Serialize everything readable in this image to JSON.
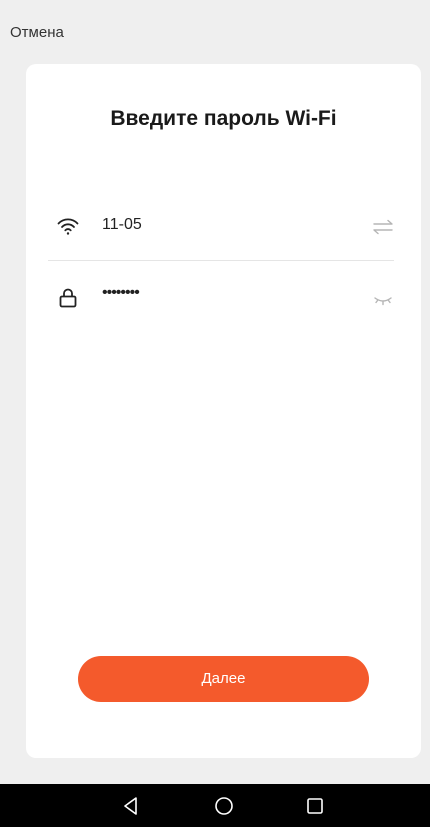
{
  "header": {
    "cancel_label": "Отмена"
  },
  "card": {
    "title": "Введите пароль Wi-Fi"
  },
  "ssid_row": {
    "icon": "wifi-icon",
    "value": "11-05",
    "action_icon": "switch-network-icon"
  },
  "password_row": {
    "icon": "lock-icon",
    "value": "••••••••",
    "action_icon": "eye-closed-icon"
  },
  "next_button": {
    "label": "Далее"
  },
  "colors": {
    "accent": "#f45a2c",
    "background": "#efefef",
    "card": "#ffffff"
  },
  "nav_bar": {
    "icons": [
      "back-icon",
      "home-icon",
      "recents-icon"
    ]
  }
}
